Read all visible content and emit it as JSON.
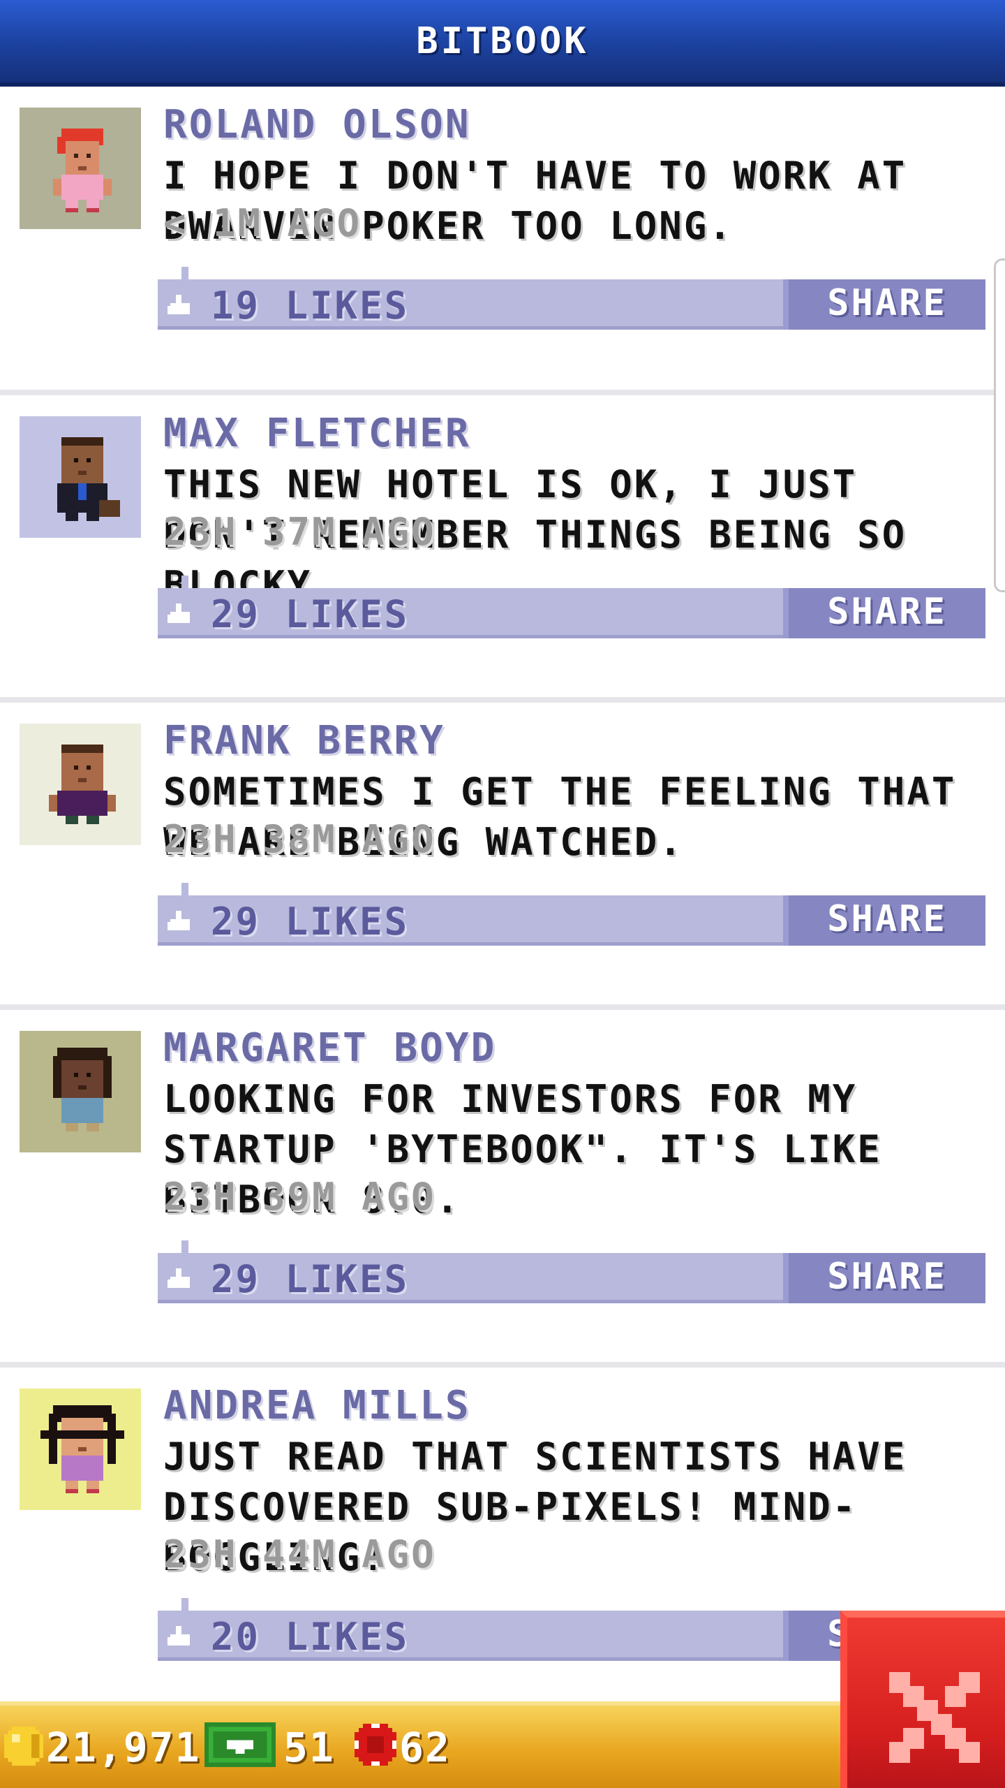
{
  "header": {
    "title": "BITBOOK"
  },
  "posts": [
    {
      "name": "ROLAND OLSON",
      "message": "I HOPE I DON'T HAVE TO WORK AT DWARVEN POKER TOO LONG.",
      "time": "< 1M AGO",
      "likes": "19 LIKES",
      "share": "SHARE",
      "avatar_bg": "#b0b196"
    },
    {
      "name": "MAX FLETCHER",
      "message": "THIS NEW HOTEL IS OK, I JUST DON'T REMEMBER THINGS BEING SO BLOCKY.",
      "time": "23H 37M AGO",
      "likes": "29 LIKES",
      "share": "SHARE",
      "avatar_bg": "#c2c3e4"
    },
    {
      "name": "FRANK BERRY",
      "message": "SOMETIMES I GET THE FEELING THAT WE ARE BEING WATCHED.",
      "time": "23H 38M AGO",
      "likes": "29 LIKES",
      "share": "SHARE",
      "avatar_bg": "#ededde"
    },
    {
      "name": "MARGARET BOYD",
      "message": "LOOKING FOR INVESTORS FOR MY STARTUP 'BYTEBOOK\". IT'S LIKE BITBOOK 8.0.",
      "time": "23H 39M AGO",
      "likes": "29 LIKES",
      "share": "SHARE",
      "avatar_bg": "#b9b88c"
    },
    {
      "name": "ANDREA MILLS",
      "message": "JUST READ THAT SCIENTISTS HAVE DISCOVERED SUB-PIXELS! MIND-BOGGLING!",
      "time": "23H 44M AGO",
      "likes": "20 LIKES",
      "share": "SHARE",
      "avatar_bg": "#eded8e"
    }
  ],
  "status_bar": {
    "coins": "21,971",
    "bux": "51",
    "chips": "62"
  },
  "colors": {
    "header_blue": "#1b3f9a",
    "name_purple": "#6a6aa6",
    "like_bar": "#b8b9dc",
    "share_button": "#8687c2",
    "gold_bar": "#e9a721",
    "close_red": "#d41e1e"
  },
  "icons": {
    "like": "thumbs-up-icon",
    "coin": "coin-icon",
    "bux": "bux-cash-icon",
    "chip": "casino-chip-icon",
    "close": "close-icon"
  }
}
